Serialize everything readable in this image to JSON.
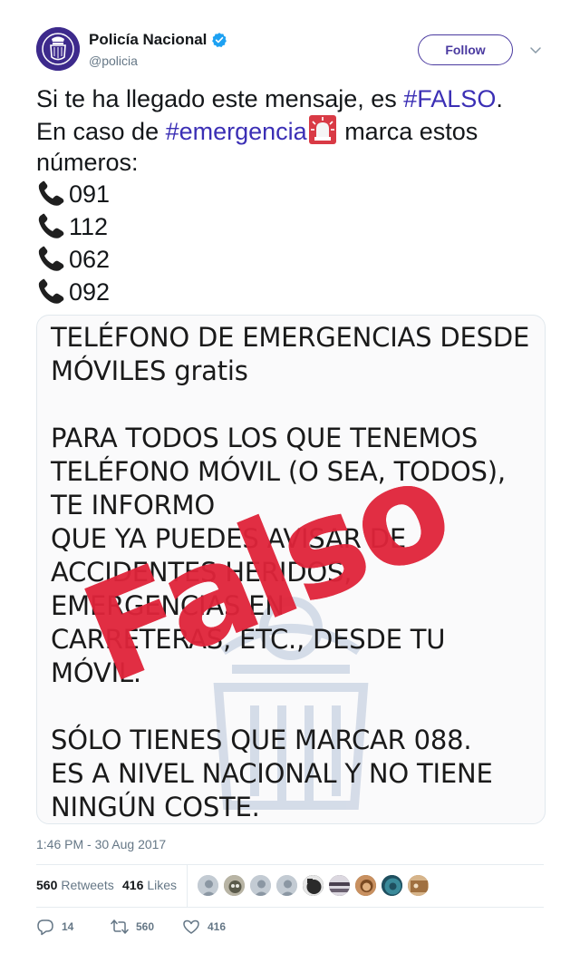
{
  "account": {
    "display_name": "Policía Nacional",
    "handle": "@policia",
    "follow_label": "Follow",
    "verified": true,
    "avatar_color": "#3d2a8c"
  },
  "tweet": {
    "line1_pre": "Si te ha llegado este mensaje, es ",
    "line1_hashtag": "#FALSO",
    "line1_post": ".",
    "line2_pre": "En caso de ",
    "line2_hashtag": "#emergencia",
    "line2_post": " marca estos",
    "line3": "números:",
    "numbers": [
      "091",
      "112",
      "062",
      "092"
    ],
    "hashtag_color": "#3b2fb5"
  },
  "media": {
    "lines": [
      "TELÉFONO DE EMERGENCIAS DESDE",
      "MÓVILES gratis",
      "",
      "PARA TODOS LOS QUE TENEMOS",
      "TELÉFONO MÓVIL (O SEA, TODOS),",
      "TE INFORMO",
      "QUE YA PUEDES AVISAR DE",
      "ACCIDENTES HERIDOS,",
      "EMERGENCIAS EN",
      "CARRETERAS, ETC., DESDE TU",
      "MÓVIL.",
      "",
      "SÓLO TIENES QUE MARCAR 088.",
      "ES A NIVEL NACIONAL Y NO TIENE",
      "NINGÚN COSTE."
    ],
    "stamp": "Falso",
    "stamp_color": "#e0243a"
  },
  "timestamp": "1:46 PM - 30 Aug 2017",
  "stats": {
    "retweets_count": "560",
    "retweets_label": "Retweets",
    "likes_count": "416",
    "likes_label": "Likes"
  },
  "actions": {
    "replies": "14",
    "retweets": "560",
    "likes": "416"
  },
  "icons": {
    "verified": "verified-badge-icon",
    "chevron": "chevron-down-icon",
    "phone": "telephone-receiver-icon",
    "siren": "police-car-light-icon",
    "reply": "reply-icon",
    "retweet": "retweet-icon",
    "like": "heart-icon"
  }
}
